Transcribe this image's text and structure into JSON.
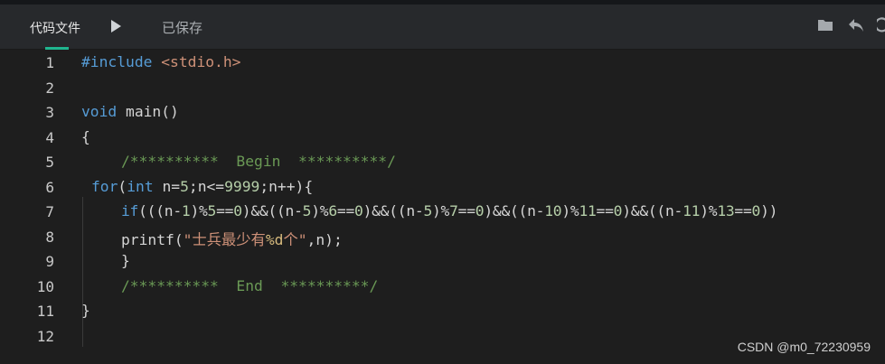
{
  "toolbar": {
    "tab_label": "代码文件",
    "saved_label": "已保存",
    "icons": [
      "folder-icon",
      "undo-icon",
      "redo-icon"
    ],
    "accent": "#1fb58f"
  },
  "editor": {
    "line_numbers": [
      "1",
      "2",
      "3",
      "4",
      "5",
      "6",
      "7",
      "8",
      "9",
      "10",
      "11",
      "12"
    ],
    "code": {
      "l1_directive": "#include",
      "l1_header": "<stdio.h>",
      "l3_void": "void",
      "l3_rest": " main()",
      "l4": "{",
      "l5_comment": "/**********  Begin  **********/",
      "l6_for": "for",
      "l6_p1": "(",
      "l6_int": "int",
      "l6_p2": " n=",
      "l6_n1": "5",
      "l6_p3": ";n<=",
      "l6_n2": "9999",
      "l6_p4": ";n++){",
      "l7_if": "if",
      "l7_a": "(((n-",
      "l7_n1": "1",
      "l7_b": ")%",
      "l7_n2": "5",
      "l7_c": "==",
      "l7_n3": "0",
      "l7_d": ")&&((n-",
      "l7_n4": "5",
      "l7_e": ")%",
      "l7_n5": "6",
      "l7_f": "==",
      "l7_n6": "0",
      "l7_g": ")&&((n-",
      "l7_n7": "5",
      "l7_h": ")%",
      "l7_n8": "7",
      "l7_i": "==",
      "l7_n9": "0",
      "l7_j": ")&&((n-",
      "l7_n10": "10",
      "l7_k": ")%",
      "l7_n11": "11",
      "l7_l": "==",
      "l7_n12": "0",
      "l7_m": ")&&((n-",
      "l7_n13": "11",
      "l7_n": ")%",
      "l7_n14": "13",
      "l7_o": "==",
      "l7_n15": "0",
      "l7_p": "))",
      "l8_fn": "printf(",
      "l8_str1": "\"士兵最少有",
      "l8_fmt": "%d",
      "l8_str2": "个\"",
      "l8_rest": ",n);",
      "l9": "}",
      "l10_comment": "/**********  End  **********/",
      "l11": "}"
    }
  },
  "watermark": "CSDN @m0_72230959"
}
